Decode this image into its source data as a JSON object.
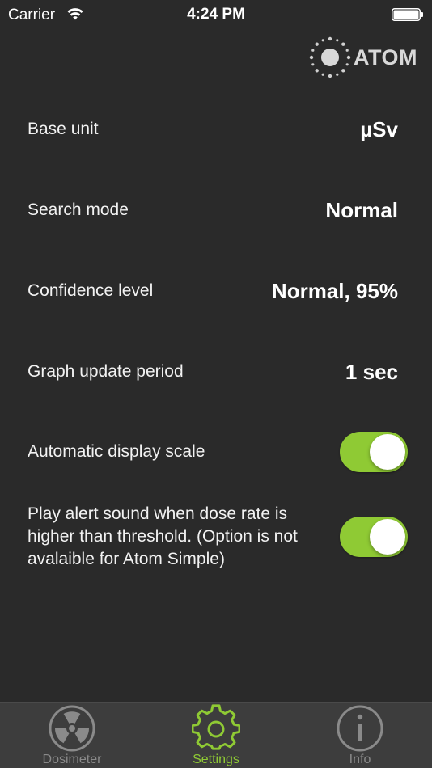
{
  "status_bar": {
    "carrier": "Carrier",
    "time": "4:24 PM"
  },
  "logo": {
    "text": "ATOM",
    "icon": "atom-logo-icon"
  },
  "settings": {
    "base_unit": {
      "label": "Base unit",
      "value": "µSv"
    },
    "search_mode": {
      "label": "Search mode",
      "value": "Normal"
    },
    "confidence_level": {
      "label": "Confidence level",
      "value": "Normal, 95%"
    },
    "graph_update_period": {
      "label": "Graph update period",
      "value": "1 sec"
    },
    "automatic_display_scale": {
      "label": "Automatic display scale",
      "on": true
    },
    "play_alert_sound": {
      "label": "Play alert sound when dose rate is higher than threshold. (Option is not avalaible for Atom Simple)",
      "on": true
    }
  },
  "tabs": [
    {
      "label": "Dosimeter",
      "icon": "radiation-icon",
      "active": false
    },
    {
      "label": "Settings",
      "icon": "gear-icon",
      "active": true
    },
    {
      "label": "Info",
      "icon": "info-icon",
      "active": false
    }
  ],
  "colors": {
    "background": "#2a2a2a",
    "accent": "#8fca34",
    "tab_bar": "#3d3d3d",
    "inactive": "#8a8a8a"
  }
}
